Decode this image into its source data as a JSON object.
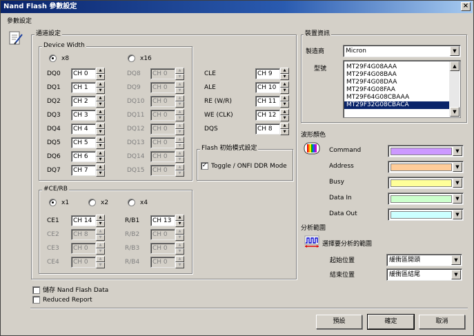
{
  "window": {
    "title": "Nand Flash 參數設定",
    "close_glyph": "×"
  },
  "section_title": "參數設定",
  "channel": {
    "title": "通道設定",
    "width_group": "Device Width",
    "x8": "x8",
    "x16": "x16",
    "dq_left": [
      {
        "n": "DQ0",
        "v": "CH 0"
      },
      {
        "n": "DQ1",
        "v": "CH 1"
      },
      {
        "n": "DQ2",
        "v": "CH 2"
      },
      {
        "n": "DQ3",
        "v": "CH 3"
      },
      {
        "n": "DQ4",
        "v": "CH 4"
      },
      {
        "n": "DQ5",
        "v": "CH 5"
      },
      {
        "n": "DQ6",
        "v": "CH 6"
      },
      {
        "n": "DQ7",
        "v": "CH 7"
      }
    ],
    "dq_right": [
      {
        "n": "DQ8",
        "v": "CH 0"
      },
      {
        "n": "DQ9",
        "v": "CH 0"
      },
      {
        "n": "DQ10",
        "v": "CH 0"
      },
      {
        "n": "DQ11",
        "v": "CH 0"
      },
      {
        "n": "DQ12",
        "v": "CH 0"
      },
      {
        "n": "DQ13",
        "v": "CH 0"
      },
      {
        "n": "DQ14",
        "v": "CH 0"
      },
      {
        "n": "DQ15",
        "v": "CH 0"
      }
    ],
    "ctrl": [
      {
        "n": "CLE",
        "v": "CH 9"
      },
      {
        "n": "ALE",
        "v": "CH 10"
      },
      {
        "n": "RE (W/R)",
        "v": "CH 11"
      },
      {
        "n": "WE (CLK)",
        "v": "CH 12"
      },
      {
        "n": "DQS",
        "v": "CH 8"
      }
    ],
    "init_group": "Flash 初始模式設定",
    "toggle_label": "Toggle / ONFI DDR Mode",
    "toggle_checked": true,
    "cerb_group": "#CE/RB",
    "x1": "x1",
    "x2": "x2",
    "x4": "x4",
    "ce": [
      {
        "n": "CE1",
        "v": "CH 14"
      },
      {
        "n": "CE2",
        "v": "CH 8"
      },
      {
        "n": "CE3",
        "v": "CH 0"
      },
      {
        "n": "CE4",
        "v": "CH 0"
      }
    ],
    "rb": [
      {
        "n": "R/B1",
        "v": "CH 13"
      },
      {
        "n": "R/B2",
        "v": "CH 0"
      },
      {
        "n": "R/B3",
        "v": "CH 0"
      },
      {
        "n": "R/B4",
        "v": "CH 0"
      }
    ]
  },
  "save_nand": "儲存 Nand Flash Data",
  "reduced_report": "Reduced Report",
  "device": {
    "title": "裝置資訊",
    "maker_label": "製造商",
    "maker": "Micron",
    "model_label": "型號",
    "models": [
      "MT29F4G08AAA",
      "MT29F4G08BAA",
      "MT29F4G08DAA",
      "MT29F4G08FAA",
      "MT29F64G08CBAAA",
      "MT29F32G08CBACA"
    ],
    "selected": 5
  },
  "wave": {
    "title": "波形顏色",
    "rows": [
      {
        "n": "Command",
        "c": "#cc99ff"
      },
      {
        "n": "Address",
        "c": "#ffcc99"
      },
      {
        "n": "Busy",
        "c": "#ffff99"
      },
      {
        "n": "Data In",
        "c": "#ccffcc"
      },
      {
        "n": "Data Out",
        "c": "#ccffff"
      }
    ]
  },
  "range": {
    "title": "分析範圍",
    "subtitle": "選擇要分析的範圍",
    "start_label": "起始位置",
    "start": "緩衝區開頭",
    "end_label": "結束位置",
    "end": "緩衝區結尾"
  },
  "buttons": {
    "default": "預設",
    "ok": "確定",
    "cancel": "取消"
  }
}
